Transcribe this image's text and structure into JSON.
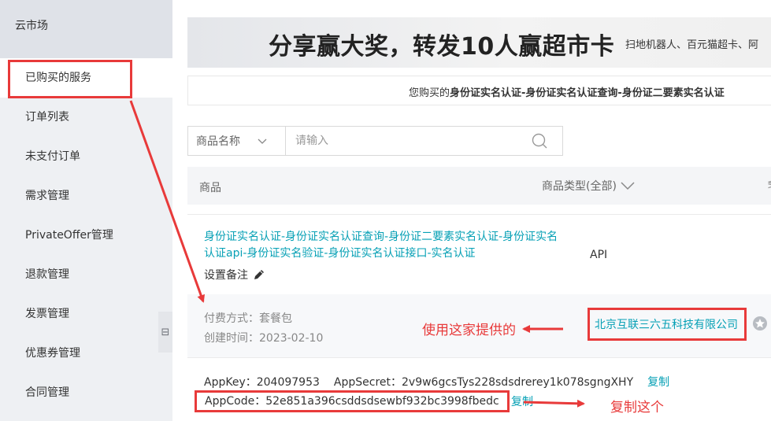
{
  "sidebar": {
    "title": "云市场",
    "items": [
      {
        "label": "已购买的服务"
      },
      {
        "label": "订单列表"
      },
      {
        "label": "未支付订单"
      },
      {
        "label": "需求管理"
      },
      {
        "label": "PrivateOffer管理"
      },
      {
        "label": "退款管理"
      },
      {
        "label": "发票管理"
      },
      {
        "label": "优惠券管理"
      },
      {
        "label": "合同管理"
      }
    ],
    "collapse_glyph": "⊟"
  },
  "banner": {
    "title": "分享赢大奖，转发10人赢超市卡",
    "subtitle": "扫地机器人、百元猫超卡、阿"
  },
  "notice": {
    "prefix": "您购买的",
    "product": "身份证实名认证-身份证实名认证查询-身份证二要素实名认证"
  },
  "search": {
    "select_label": "商品名称",
    "placeholder": "请输入"
  },
  "table": {
    "col_product": "商品",
    "col_type": "商品类型(全部)",
    "col_more": "≶"
  },
  "row": {
    "product_name": "身份证实名认证-身份证实名认证查询-身份证二要素实名认证-身份证实名认证api-身份证实名验证-身份证实名认证接口-实名认证",
    "remark_label": "设置备注",
    "type": "API",
    "pay_method": "付费方式：套餐包",
    "created_time": "创建时间：2023-02-10",
    "provider": "北京互联三六五科技有限公司",
    "appkey": "AppKey：204097953",
    "appsecret": "AppSecret：2v9w6gcsTys228sdsdrerey1k078sgngXHY",
    "copy_label": "复制",
    "appcode": "AppCode：52e851a396csddsdsewbf932bc3998fbedc"
  },
  "annotations": {
    "use_provider": "使用这家提供的",
    "copy_this": "复制这个",
    "color": "#e83a3a"
  },
  "colors": {
    "link": "#06a0b5",
    "sidebar_bg": "#eef0f3"
  }
}
